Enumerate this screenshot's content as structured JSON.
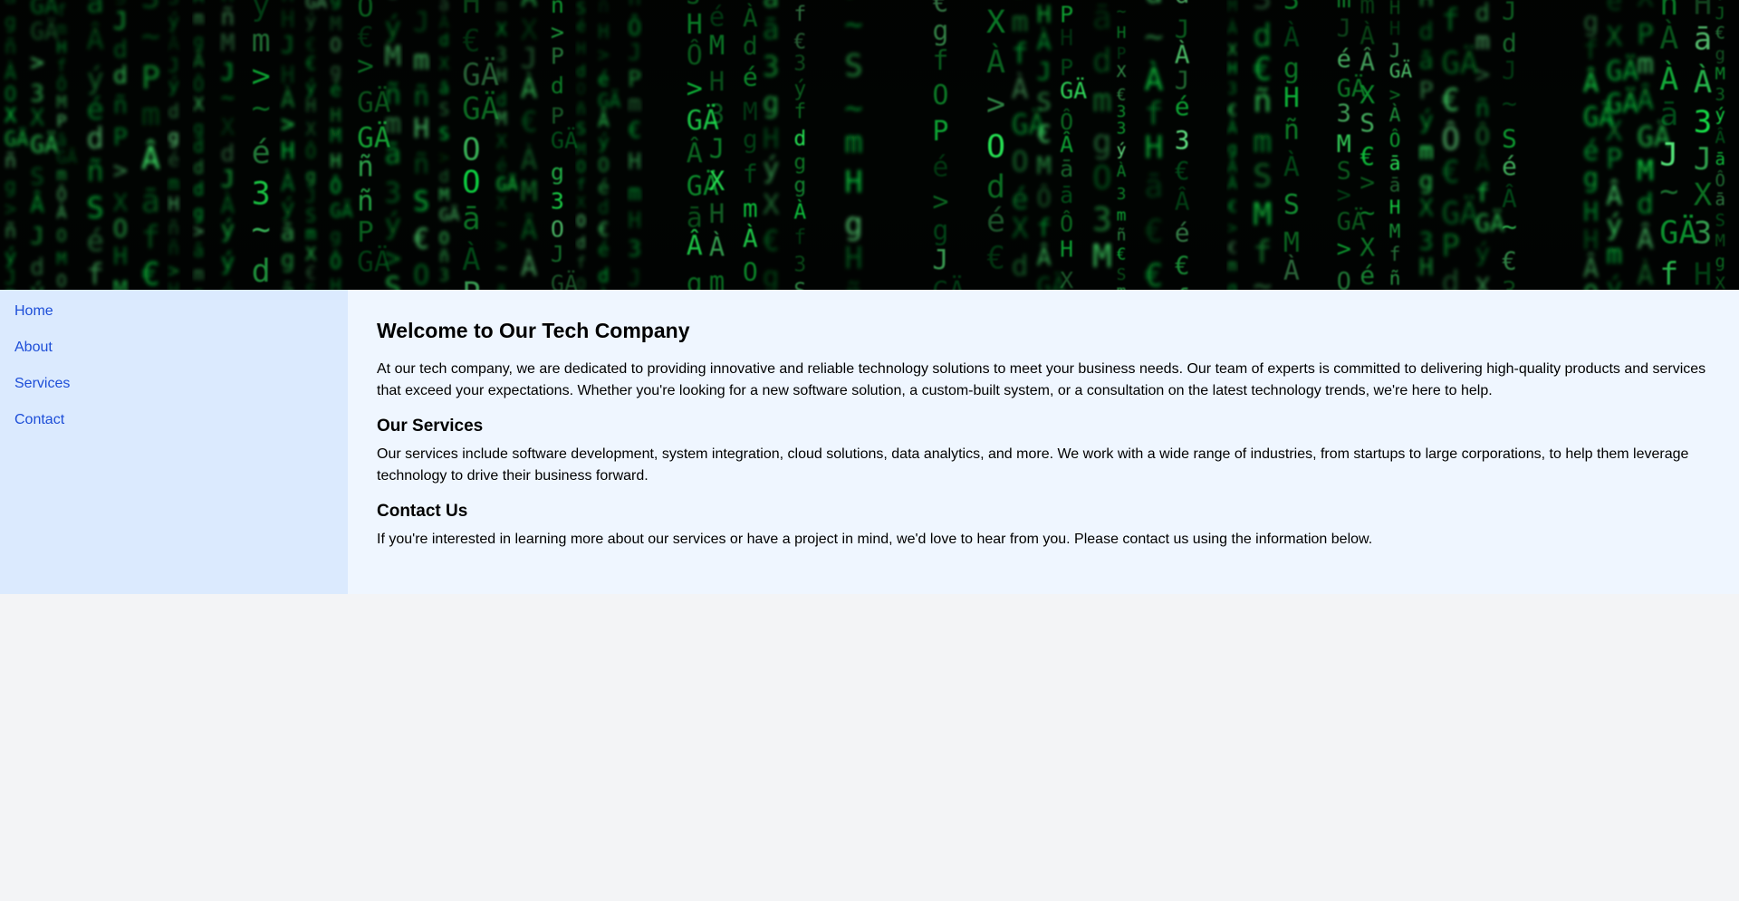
{
  "hero": {
    "glyphs": [
      "d",
      "f",
      "J",
      "H",
      "X",
      "ñ",
      "GÄ",
      "é",
      "m",
      "Ô",
      "Â",
      "À",
      "3",
      "S",
      "P",
      "ý",
      "M",
      "g",
      "€",
      "~",
      "ā",
      ">",
      "O"
    ]
  },
  "sidebar": {
    "items": [
      {
        "label": "Home"
      },
      {
        "label": "About"
      },
      {
        "label": "Services"
      },
      {
        "label": "Contact"
      }
    ]
  },
  "main": {
    "title": "Welcome to Our Tech Company",
    "intro": "At our tech company, we are dedicated to providing innovative and reliable technology solutions to meet your business needs. Our team of experts is committed to delivering high-quality products and services that exceed your expectations. Whether you're looking for a new software solution, a custom-built system, or a consultation on the latest technology trends, we're here to help.",
    "services_heading": "Our Services",
    "services_text": "Our services include software development, system integration, cloud solutions, data analytics, and more. We work with a wide range of industries, from startups to large corporations, to help them leverage technology to drive their business forward.",
    "contact_heading": "Contact Us",
    "contact_text": "If you're interested in learning more about our services or have a project in mind, we'd love to hear from you. Please contact us using the information below."
  },
  "colors": {
    "accent": "#1d4ed8",
    "sidebar_bg": "#dbeafe",
    "main_bg": "#eff6ff",
    "page_bg": "#f3f4f6",
    "code_green": "#22c55e"
  }
}
